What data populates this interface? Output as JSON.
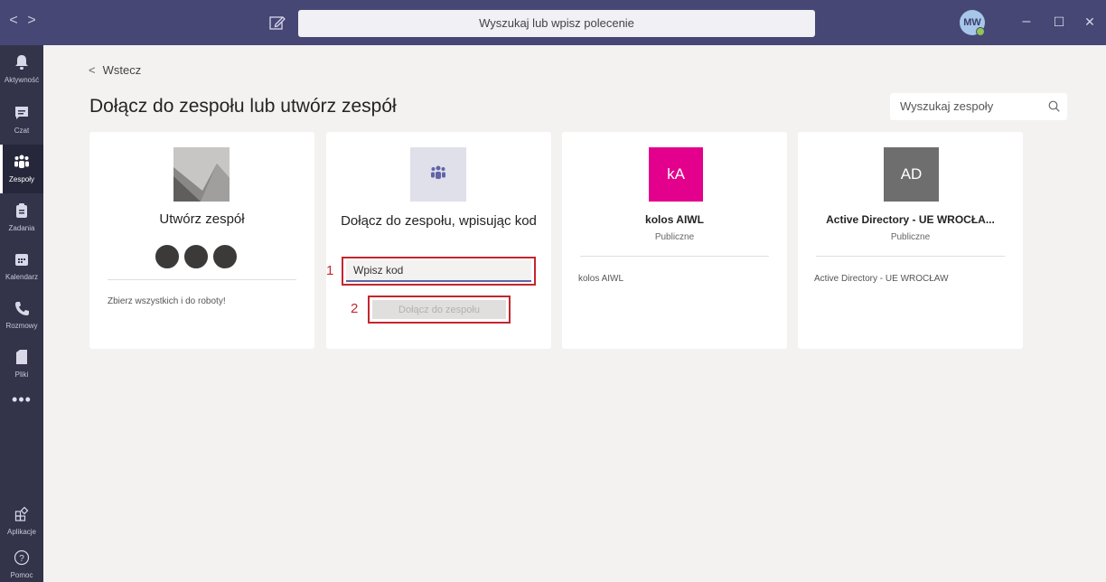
{
  "titlebar": {
    "back_arrow": "<",
    "forward_arrow": ">",
    "search_placeholder": "Wyszukaj lub wpisz polecenie",
    "avatar_initials": "MW",
    "minimize": "–",
    "maximize": "☐",
    "close": "✕"
  },
  "rail": {
    "items": [
      {
        "label": "Aktywność",
        "icon": "bell-icon"
      },
      {
        "label": "Czat",
        "icon": "chat-icon"
      },
      {
        "label": "Zespoły",
        "icon": "teams-icon",
        "active": true
      },
      {
        "label": "Zadania",
        "icon": "tasks-icon"
      },
      {
        "label": "Kalendarz",
        "icon": "calendar-icon"
      },
      {
        "label": "Rozmowy",
        "icon": "phone-icon"
      },
      {
        "label": "Pliki",
        "icon": "file-icon"
      }
    ],
    "more": "•••",
    "apps_label": "Aplikacje",
    "help_label": "Pomoc"
  },
  "main": {
    "back_label": "Wstecz",
    "page_title": "Dołącz do zespołu lub utwórz zespół",
    "team_search_placeholder": "Wyszukaj zespoły"
  },
  "cards": {
    "create": {
      "title": "Utwórz zespół",
      "description": "Zbierz wszystkich i do roboty!"
    },
    "join": {
      "title": "Dołącz do zespołu, wpisując kod",
      "code_placeholder": "Wpisz kod",
      "join_button": "Dołącz do zespołu",
      "step1": "1",
      "step2": "2"
    },
    "team1": {
      "initials": "kA",
      "title": "kolos AIWL",
      "visibility": "Publiczne",
      "description": "kolos AIWL",
      "color": "#e3008c"
    },
    "team2": {
      "initials": "AD",
      "title": "Active Directory - UE WROCŁA...",
      "visibility": "Publiczne",
      "description": "Active Directory - UE WROCŁAW",
      "color": "#6e6e6e"
    }
  },
  "colors": {
    "titlebar": "#464775",
    "rail": "#33344a",
    "accent": "#6264a7",
    "highlight_border": "#c4262e"
  }
}
